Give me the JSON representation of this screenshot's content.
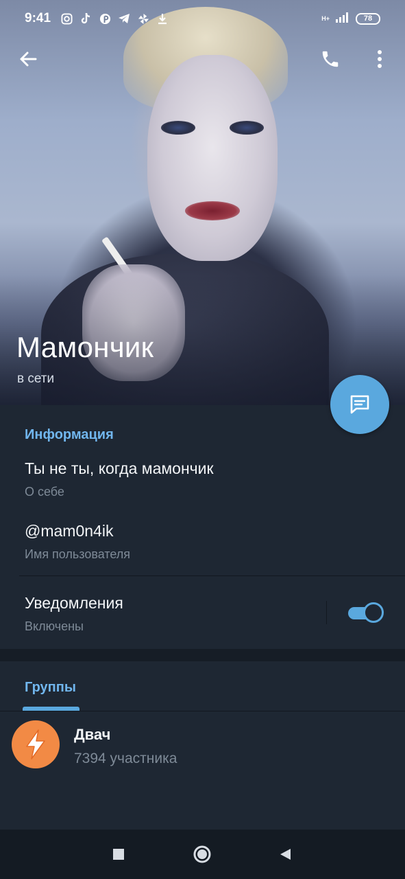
{
  "status_bar": {
    "time": "9:41",
    "network": "H+",
    "battery": "78",
    "icons": [
      "instagram-icon",
      "tiktok-icon",
      "pinterest-icon",
      "telegram-icon",
      "pinwheel-icon",
      "download-icon"
    ]
  },
  "profile": {
    "name": "Мамончик",
    "status": "в сети"
  },
  "info": {
    "section_title": "Информация",
    "bio": "Ты не ты, когда мамончик",
    "bio_label": "О себе",
    "username": "@mam0n4ik",
    "username_label": "Имя пользователя",
    "notifications": "Уведомления",
    "notifications_state": "Включены",
    "notifications_enabled": true
  },
  "groups": {
    "tab_label": "Группы",
    "items": [
      {
        "name": "Двач",
        "members": "7394 участника",
        "avatar_color": "#f28a45"
      }
    ]
  },
  "colors": {
    "accent": "#5aa8de",
    "background": "#1e2733",
    "section_title": "#71b6ee"
  }
}
